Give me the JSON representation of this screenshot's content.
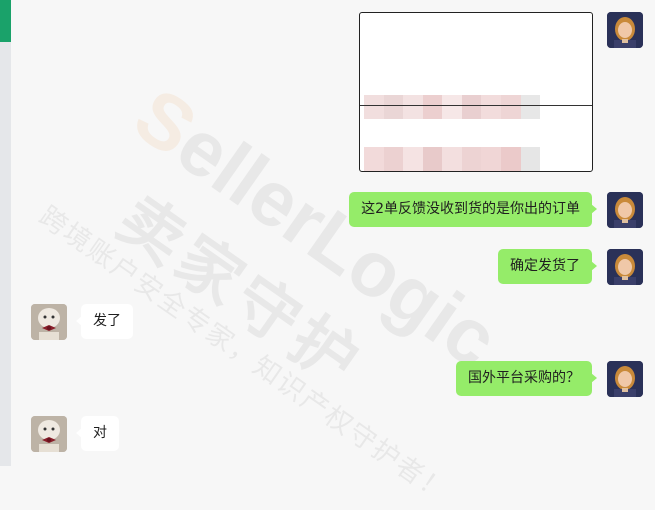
{
  "watermark": {
    "brand_first": "S",
    "brand_rest": "ellerLogic",
    "cn_name": "卖家守护",
    "slogan": "跨境账户安全专家，知识产权守护者！"
  },
  "colors": {
    "my_bubble": "#95ec69",
    "their_bubble": "#ffffff",
    "background": "#f7f7f7",
    "accent": "#1aa26a"
  },
  "messages": [
    {
      "sender": "me",
      "type": "image",
      "content": "redacted-order-image"
    },
    {
      "sender": "me",
      "type": "text",
      "text": "这2单反馈没收到货的是你出的订单"
    },
    {
      "sender": "me",
      "type": "text",
      "text": "确定发货了"
    },
    {
      "sender": "them",
      "type": "text",
      "text": "发了"
    },
    {
      "sender": "me",
      "type": "text",
      "text": "国外平台采购的？"
    },
    {
      "sender": "them",
      "type": "text",
      "text": "对"
    }
  ]
}
